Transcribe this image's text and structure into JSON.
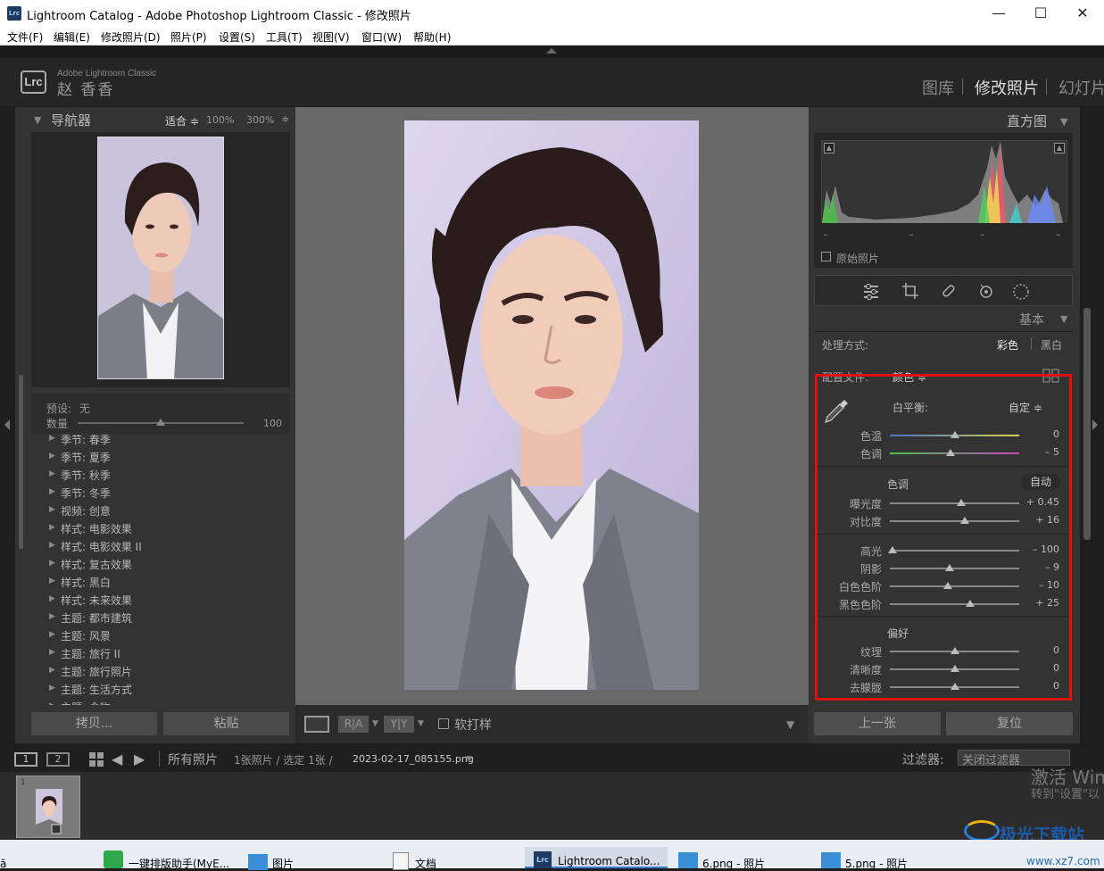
{
  "window": {
    "title": "Lightroom Catalog - Adobe Photoshop Lightroom Classic - 修改照片",
    "app_icon": "Lrc",
    "controls": [
      "minimize",
      "maximize",
      "close"
    ]
  },
  "menu": [
    "文件(F)",
    "编辑(E)",
    "修改照片(D)",
    "照片(P)",
    "设置(S)",
    "工具(T)",
    "视图(V)",
    "窗口(W)",
    "帮助(H)"
  ],
  "identity": {
    "logo": "Lrc",
    "product": "Adobe Lightroom Classic",
    "user": "赵 香香"
  },
  "modules": [
    "图库",
    "修改照片",
    "幻灯片"
  ],
  "navigator": {
    "title": "导航器",
    "zoom_fit": "适合 ≑",
    "zoom_100": "100%",
    "zoom_300": "300%",
    "zoom_more": "≑"
  },
  "presets": {
    "preset_label": "预设:",
    "preset_value": "无",
    "amount_label": "数量",
    "amount_value": "100",
    "items": [
      "季节: 春季",
      "季节: 夏季",
      "季节: 秋季",
      "季节: 冬季",
      "视频: 创意",
      "样式: 电影效果",
      "样式: 电影效果 II",
      "样式: 复古效果",
      "样式: 黑白",
      "样式: 未来效果",
      "主题: 都市建筑",
      "主题: 风景",
      "主题: 旅行 II",
      "主题: 旅行照片",
      "主题: 生活方式",
      "主题: 食物"
    ]
  },
  "left_buttons": {
    "copy": "拷贝...",
    "paste": "粘贴"
  },
  "center_toolbar": {
    "proof_label": "软打样",
    "ra": "R|A",
    "yy": "Y|Y"
  },
  "histogram": {
    "title": "直方图",
    "original_photo": "原始照片",
    "readouts": [
      "–",
      "–",
      "–",
      "–"
    ]
  },
  "tools": [
    "sliders-icon",
    "crop-icon",
    "bandage-icon",
    "redeye-icon",
    "mask-icon"
  ],
  "basic": {
    "title": "基本",
    "treatment_label": "处理方式:",
    "color": "彩色",
    "bw": "黑白",
    "profile_label": "配置文件:",
    "profile_value": "颜色 ≑",
    "wb_label": "白平衡:",
    "wb_value": "自定 ≑",
    "temp_label": "色温",
    "temp_value": "0",
    "tint_label": "色调",
    "tint_value": "– 5",
    "tone_label": "色调",
    "auto": "自动",
    "exposure_label": "曝光度",
    "exposure_value": "+ 0.45",
    "contrast_label": "对比度",
    "contrast_value": "+ 16",
    "highlights_label": "高光",
    "highlights_value": "– 100",
    "shadows_label": "阴影",
    "shadows_value": "– 9",
    "whites_label": "白色色阶",
    "whites_value": "– 10",
    "blacks_label": "黑色色阶",
    "blacks_value": "+ 25",
    "presence_label": "偏好",
    "texture_label": "纹理",
    "texture_value": "0",
    "clarity_label": "清晰度",
    "clarity_value": "0",
    "dehaze_label": "去朦胧",
    "dehaze_value": "0",
    "slider_positions": {
      "temp": 0.5,
      "tint": 0.47,
      "exposure": 0.55,
      "contrast": 0.58,
      "highlights": 0.02,
      "shadows": 0.46,
      "whites": 0.45,
      "blacks": 0.62,
      "texture": 0.5,
      "clarity": 0.5,
      "dehaze": 0.5
    }
  },
  "right_buttons": {
    "prev": "上一张",
    "reset": "复位"
  },
  "filmstrip_bar": {
    "view1": "1",
    "view2": "2",
    "source": "所有照片",
    "count": "1张照片 / 选定 1张 /",
    "filename": "2023-02-17_085155.png",
    "filter_label": "过滤器:",
    "filter_value": "关闭过滤器"
  },
  "thumb_index": "1",
  "watermark": {
    "line1": "激活 Win",
    "line2": "转到\"设置\"以",
    "site": "极光下载站",
    "url": "www.xz7.com"
  },
  "taskbar": [
    "一键排版助手(MyE...",
    "图片",
    "文档",
    "Lightroom Catalo...",
    "6.png - 照片",
    "5.png - 照片"
  ]
}
